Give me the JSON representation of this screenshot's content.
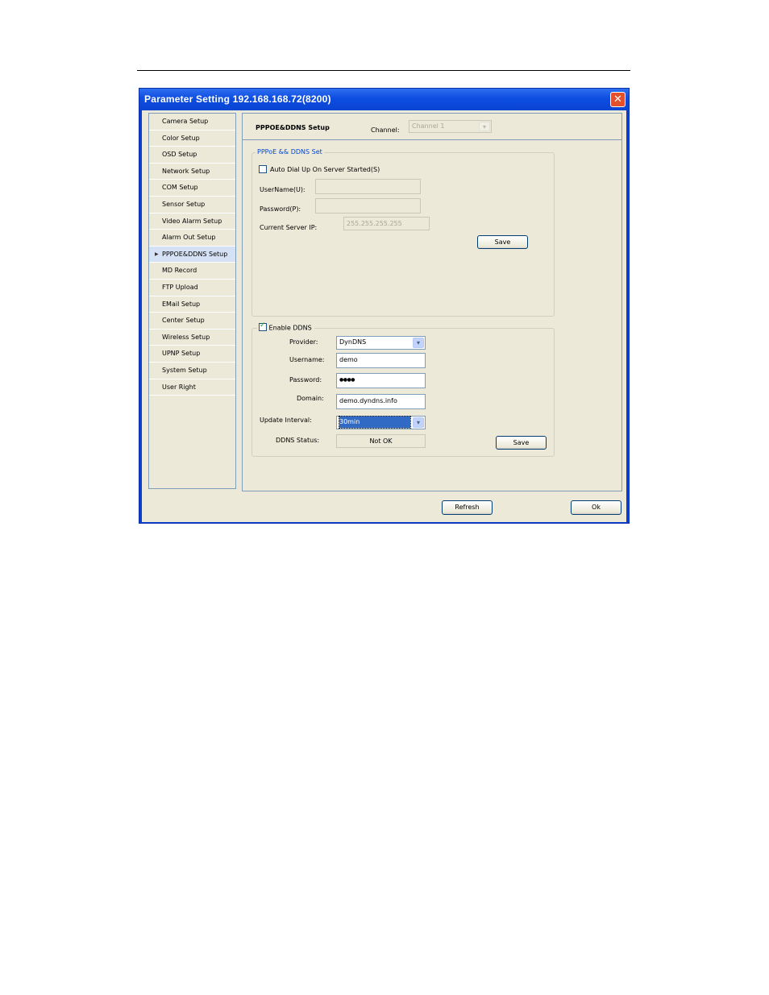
{
  "window": {
    "title": "Parameter Setting 192.168.168.72(8200)",
    "close_glyph": "✕"
  },
  "sidebar": {
    "items": [
      {
        "label": "Camera Setup"
      },
      {
        "label": "Color Setup"
      },
      {
        "label": "OSD Setup"
      },
      {
        "label": "Network Setup"
      },
      {
        "label": "COM Setup"
      },
      {
        "label": "Sensor Setup"
      },
      {
        "label": "Video Alarm Setup"
      },
      {
        "label": "Alarm Out Setup"
      },
      {
        "label": "PPPOE&DDNS Setup"
      },
      {
        "label": "MD Record"
      },
      {
        "label": "FTP Upload"
      },
      {
        "label": "EMail Setup"
      },
      {
        "label": "Center Setup"
      },
      {
        "label": "Wireless Setup"
      },
      {
        "label": "UPNP Setup"
      },
      {
        "label": "System Setup"
      },
      {
        "label": "User Right"
      }
    ],
    "active_index": 8,
    "active_marker_glyph": "▶"
  },
  "main": {
    "title": "PPPOE&DDNS Setup",
    "channel_label": "Channel:",
    "channel_value": "Channel 1"
  },
  "pppoe": {
    "legend": "PPPoE && DDNS Set",
    "auto_dial_label": "Auto Dial Up On Server Started(S)",
    "auto_dial_checked": false,
    "username_label": "UserName(U):",
    "username_value": "",
    "password_label": "Password(P):",
    "password_value": "",
    "server_ip_label": "Current Server IP:",
    "server_ip_value": "255.255.255.255",
    "save_label": "Save"
  },
  "ddns": {
    "enable_label": "Enable DDNS",
    "enabled": true,
    "provider_label": "Provider:",
    "provider_value": "DynDNS",
    "username_label": "Username:",
    "username_value": "demo",
    "password_label": "Password:",
    "password_value": "●●●●",
    "domain_label": "Domain:",
    "domain_value": "demo.dyndns.info",
    "interval_label": "Update Interval:",
    "interval_value": "30min",
    "status_label": "DDNS Status:",
    "status_value": "Not OK",
    "save_label": "Save"
  },
  "footer": {
    "refresh_label": "Refresh",
    "ok_label": "Ok"
  },
  "icons": {
    "dropdown_arrow": "chevron-down-icon",
    "check": "checkmark-icon"
  },
  "colors": {
    "titlebar": "#0d4de0",
    "client_bg": "#ece9d8",
    "legend_blue": "#0046d5",
    "active_item": "#d5e2f5"
  }
}
